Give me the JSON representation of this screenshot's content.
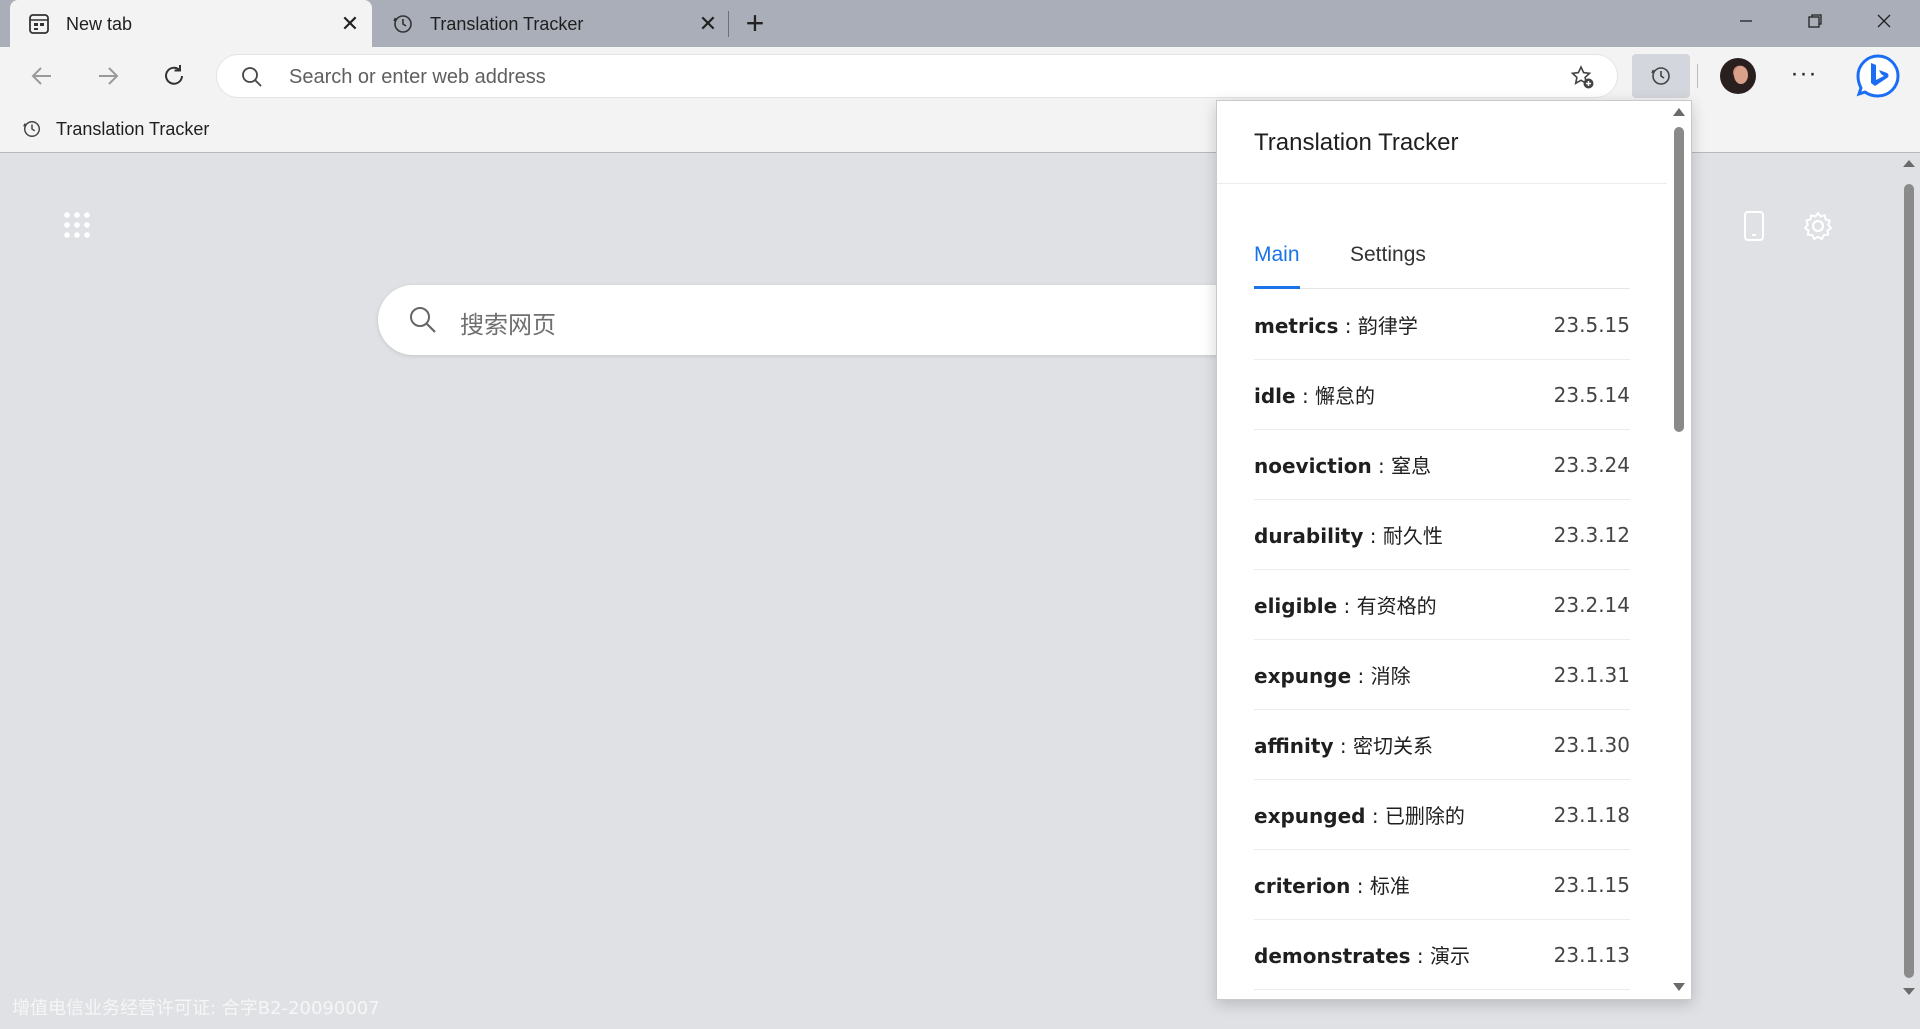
{
  "tabs": [
    {
      "title": "New tab",
      "icon": "newtab-page-icon",
      "active": true
    },
    {
      "title": "Translation Tracker",
      "icon": "history-clock-icon",
      "active": false
    }
  ],
  "toolbar": {
    "address_placeholder": "Search or enter web address"
  },
  "bookmarks": [
    {
      "label": "Translation Tracker",
      "icon": "history-clock-icon"
    }
  ],
  "page": {
    "search_placeholder": "搜索网页",
    "license": "增值电信业务经营许可证: 合字B2-20090007"
  },
  "popup": {
    "title": "Translation Tracker",
    "tabs": [
      "Main",
      "Settings"
    ],
    "active_tab": "Main",
    "accent_color": "#1a73e8",
    "words": [
      {
        "term": "metrics",
        "translation": "韵律学",
        "date": "23.5.15"
      },
      {
        "term": "idle",
        "translation": "懈怠的",
        "date": "23.5.14"
      },
      {
        "term": "noeviction",
        "translation": "窒息",
        "date": "23.3.24"
      },
      {
        "term": "durability",
        "translation": "耐久性",
        "date": "23.3.12"
      },
      {
        "term": "eligible",
        "translation": "有资格的",
        "date": "23.2.14"
      },
      {
        "term": "expunge",
        "translation": "消除",
        "date": "23.1.31"
      },
      {
        "term": "affinity",
        "translation": "密切关系",
        "date": "23.1.30"
      },
      {
        "term": "expunged",
        "translation": "已删除的",
        "date": "23.1.18"
      },
      {
        "term": "criterion",
        "translation": "标准",
        "date": "23.1.15"
      },
      {
        "term": "demonstrates",
        "translation": "演示",
        "date": "23.1.13"
      }
    ]
  }
}
